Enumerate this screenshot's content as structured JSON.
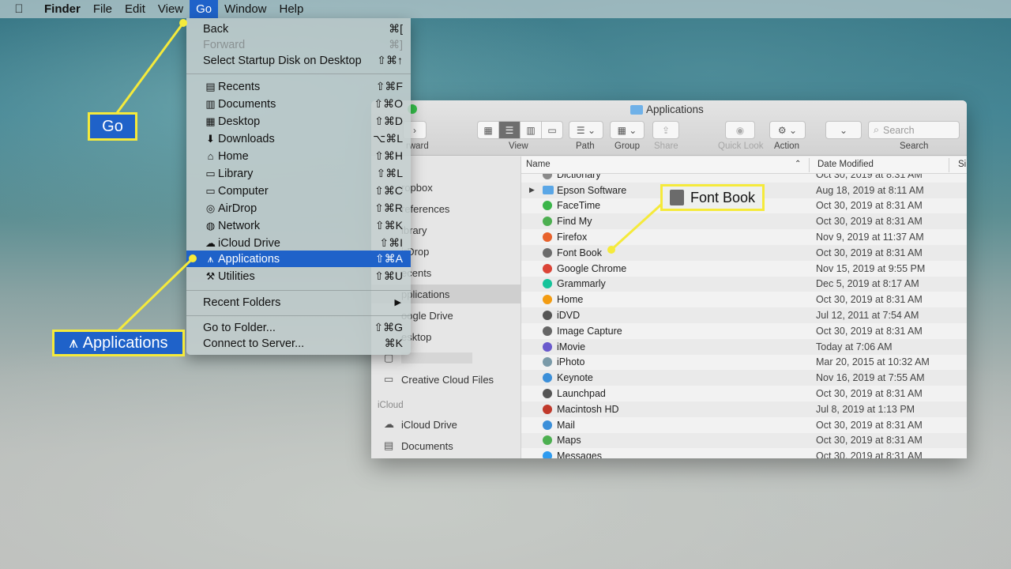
{
  "menubar": {
    "apple_icon": "apple-logo",
    "app": "Finder",
    "items": [
      "File",
      "Edit",
      "View",
      "Go",
      "Window",
      "Help"
    ],
    "active": "Go"
  },
  "go_menu": {
    "groups": [
      [
        {
          "label": "Back",
          "shortcut": "⌘[",
          "icon": "",
          "disabled": false
        },
        {
          "label": "Forward",
          "shortcut": "⌘]",
          "icon": "",
          "disabled": true
        },
        {
          "label": "Select Startup Disk on Desktop",
          "shortcut": "⇧⌘↑",
          "icon": "",
          "disabled": false
        }
      ],
      [
        {
          "label": "Recents",
          "shortcut": "⇧⌘F",
          "icon": "recents-icon"
        },
        {
          "label": "Documents",
          "shortcut": "⇧⌘O",
          "icon": "documents-icon"
        },
        {
          "label": "Desktop",
          "shortcut": "⇧⌘D",
          "icon": "desktop-icon"
        },
        {
          "label": "Downloads",
          "shortcut": "⌥⌘L",
          "icon": "downloads-icon"
        },
        {
          "label": "Home",
          "shortcut": "⇧⌘H",
          "icon": "home-icon"
        },
        {
          "label": "Library",
          "shortcut": "⇧⌘L",
          "icon": "library-folder-icon"
        },
        {
          "label": "Computer",
          "shortcut": "⇧⌘C",
          "icon": "computer-icon"
        },
        {
          "label": "AirDrop",
          "shortcut": "⇧⌘R",
          "icon": "airdrop-icon"
        },
        {
          "label": "Network",
          "shortcut": "⇧⌘K",
          "icon": "network-icon"
        },
        {
          "label": "iCloud Drive",
          "shortcut": "⇧⌘I",
          "icon": "icloud-icon"
        },
        {
          "label": "Applications",
          "shortcut": "⇧⌘A",
          "icon": "applications-icon",
          "selected": true
        },
        {
          "label": "Utilities",
          "shortcut": "⇧⌘U",
          "icon": "utilities-icon"
        }
      ],
      [
        {
          "label": "Recent Folders",
          "submenu": true
        }
      ],
      [
        {
          "label": "Go to Folder...",
          "shortcut": "⇧⌘G"
        },
        {
          "label": "Connect to Server...",
          "shortcut": "⌘K"
        }
      ]
    ]
  },
  "callouts": {
    "go": "Go",
    "applications": "Applications",
    "font_book": "Font Book"
  },
  "finder": {
    "title": "Applications",
    "toolbar": {
      "forward_label": "rward",
      "view_label": "View",
      "path_label": "Path",
      "group_label": "Group",
      "share_label": "Share",
      "quicklook_label": "Quick Look",
      "action_label": "Action",
      "search_placeholder": "Search",
      "search_label": "Search"
    },
    "sidebar": {
      "items": [
        {
          "label": "ropbox",
          "icon": ""
        },
        {
          "label": "references",
          "icon": ""
        },
        {
          "label": "ibrary",
          "icon": ""
        },
        {
          "label": "irDrop",
          "icon": ""
        },
        {
          "label": "ecents",
          "icon": ""
        },
        {
          "label": "pplications",
          "icon": "",
          "selected": true
        },
        {
          "label": "oogle Drive",
          "icon": ""
        },
        {
          "label": "esktop",
          "icon": ""
        },
        {
          "label": "",
          "icon": "folder-icon"
        },
        {
          "label": "Creative Cloud Files",
          "icon": "folder-icon"
        }
      ],
      "icloud_header": "iCloud",
      "icloud_items": [
        {
          "label": "iCloud Drive",
          "icon": "icloud-icon"
        },
        {
          "label": "Documents",
          "icon": "documents-icon"
        }
      ]
    },
    "columns": {
      "name": "Name",
      "date": "Date Modified",
      "size": "Si"
    },
    "files": [
      {
        "name": "Dictionary",
        "date": "Oct 30, 2019 at 8:31 AM",
        "color": "#8a8a8a",
        "partial": true
      },
      {
        "name": "Epson Software",
        "date": "Aug 18, 2019 at 8:11 AM",
        "color": "#5aa6e6",
        "folder": true
      },
      {
        "name": "FaceTime",
        "date": "Oct 30, 2019 at 8:31 AM",
        "color": "#3bb54a"
      },
      {
        "name": "Find My",
        "date": "Oct 30, 2019 at 8:31 AM",
        "color": "#4caf50"
      },
      {
        "name": "Firefox",
        "date": "Nov 9, 2019 at 11:37 AM",
        "color": "#e8622c"
      },
      {
        "name": "Font Book",
        "date": "Oct 30, 2019 at 8:31 AM",
        "color": "#6b6b6b"
      },
      {
        "name": "Google Chrome",
        "date": "Nov 15, 2019 at 9:55 PM",
        "color": "#db4437"
      },
      {
        "name": "Grammarly",
        "date": "Dec 5, 2019 at 8:17 AM",
        "color": "#15c39a"
      },
      {
        "name": "Home",
        "date": "Oct 30, 2019 at 8:31 AM",
        "color": "#f39c12"
      },
      {
        "name": "iDVD",
        "date": "Jul 12, 2011 at 7:54 AM",
        "color": "#555555"
      },
      {
        "name": "Image Capture",
        "date": "Oct 30, 2019 at 8:31 AM",
        "color": "#666666"
      },
      {
        "name": "iMovie",
        "date": "Today at 7:06 AM",
        "color": "#6a5acd"
      },
      {
        "name": "iPhoto",
        "date": "Mar 20, 2015 at 10:32 AM",
        "color": "#7a9aa8"
      },
      {
        "name": "Keynote",
        "date": "Nov 16, 2019 at 7:55 AM",
        "color": "#3b8fd9"
      },
      {
        "name": "Launchpad",
        "date": "Oct 30, 2019 at 8:31 AM",
        "color": "#555555"
      },
      {
        "name": "Macintosh HD",
        "date": "Jul 8, 2019 at 1:13 PM",
        "color": "#c0392b"
      },
      {
        "name": "Mail",
        "date": "Oct 30, 2019 at 8:31 AM",
        "color": "#3b8fd9"
      },
      {
        "name": "Maps",
        "date": "Oct 30, 2019 at 8:31 AM",
        "color": "#4caf50"
      },
      {
        "name": "Messages",
        "date": "Oct 30, 2019 at 8:31 AM",
        "color": "#2e9bf0"
      }
    ]
  },
  "colors": {
    "selection": "#1f62c9",
    "callout_border": "#f5ea3b"
  }
}
